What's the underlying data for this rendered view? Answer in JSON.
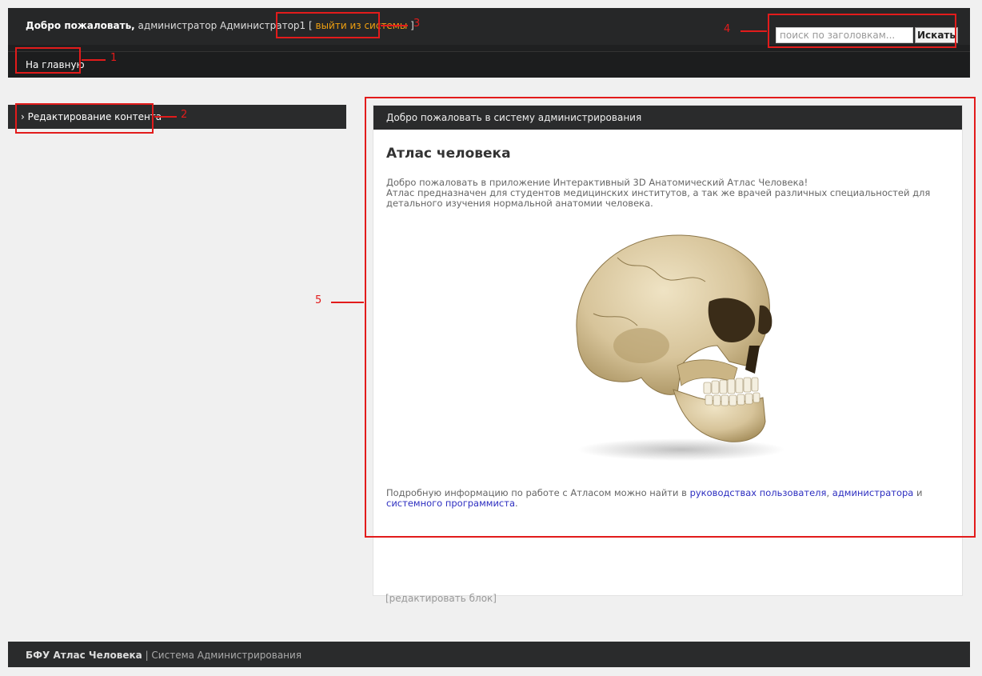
{
  "header": {
    "welcome_bold": "Добро пожаловать,",
    "welcome_user": " администратор Администратор1",
    "logout_open": "[ ",
    "logout_label": "выйти из системы",
    "logout_close": " ]",
    "home_label": "На главную",
    "search_placeholder": "поиск по заголовкам...",
    "search_button": "Искать"
  },
  "sidebar": {
    "items": [
      {
        "label": "› Редактирование контента"
      }
    ]
  },
  "main": {
    "panel_title": "Добро пожаловать в систему администрирования",
    "article_title": "Атлас человека",
    "paragraph_1": "Добро пожаловать в приложение Интерактивный 3D Анатомический Атлас Человека!",
    "paragraph_2": "Атлас предназначен для студентов медицинских институтов, а так же врачей различных специальностей для детального изучения нормальной анатомии человека.",
    "footer_text_1": "Подробную информацию по работе с Атласом можно найти в ",
    "link_users": "руководствах пользователя",
    "footer_text_2": ", ",
    "link_admin": "администратора",
    "footer_text_3": " и ",
    "link_sysprog": "системного программиста",
    "footer_text_4": ".",
    "image": "skull-image",
    "edit_block": "[редактировать блок]"
  },
  "footer": {
    "brand": "БФУ Атлас Человека",
    "separator": " | ",
    "subtitle": "Система Администрирования"
  },
  "annotations": [
    "1",
    "2",
    "3",
    "4",
    "5"
  ],
  "colors": {
    "annotation": "#e21b1b",
    "header_bg": "#262728",
    "logout": "#f0a010",
    "link": "#2d2ec0"
  }
}
